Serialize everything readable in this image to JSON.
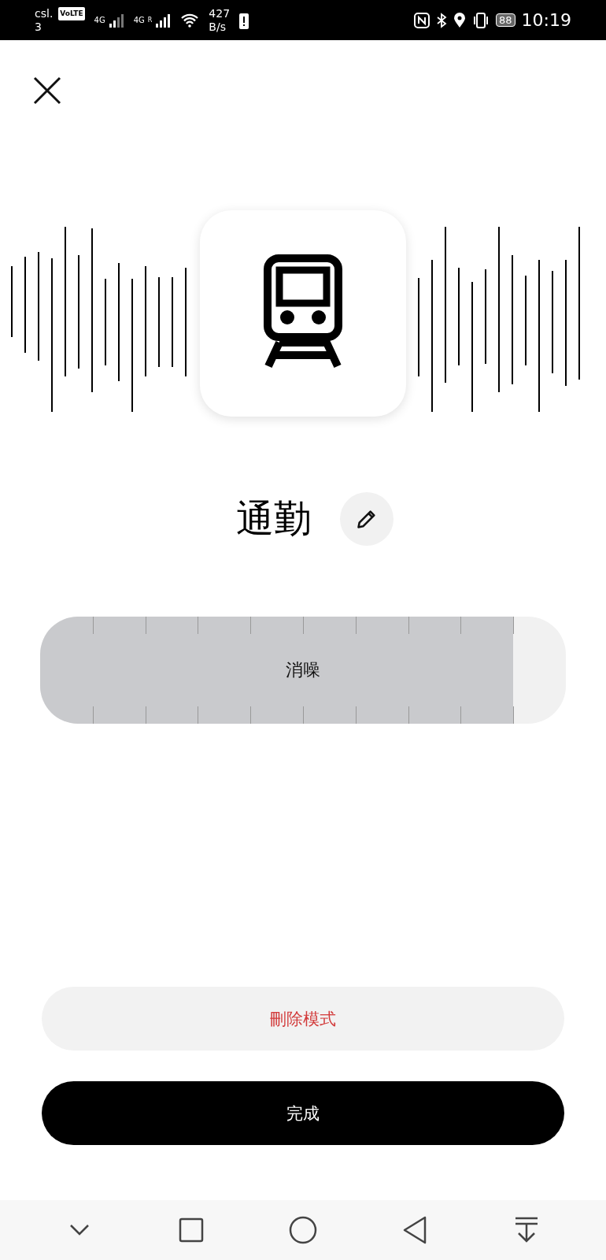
{
  "status_bar": {
    "carrier": "csl.",
    "carrier_line2": "3",
    "volte": "VoLTE",
    "network_1": "4G",
    "network_2": "4G",
    "network_2_flag": "R",
    "speed_value": "427",
    "speed_unit": "B/s",
    "battery": "88",
    "time": "10:19"
  },
  "mode": {
    "name": "通勤"
  },
  "slider": {
    "label": "消噪",
    "level": 0.9
  },
  "buttons": [
    {
      "label": "刪除模式",
      "kind": "danger"
    },
    {
      "label": "完成",
      "kind": "primary"
    }
  ]
}
